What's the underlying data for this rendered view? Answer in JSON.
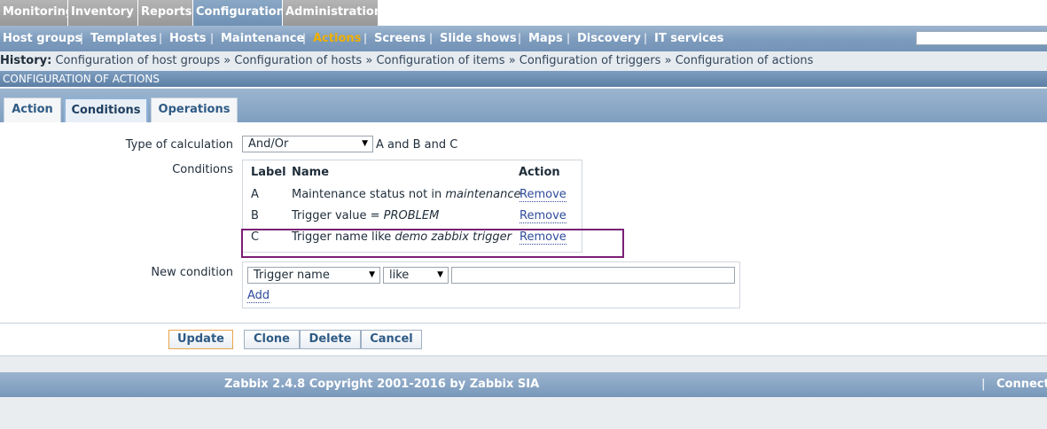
{
  "top_menu": [
    {
      "label": "Monitoring",
      "active": false
    },
    {
      "label": "Inventory",
      "active": false
    },
    {
      "label": "Reports",
      "active": false
    },
    {
      "label": "Configuration",
      "active": true
    },
    {
      "label": "Administration",
      "active": false
    }
  ],
  "sub_menu": [
    {
      "label": "Host groups",
      "active": false
    },
    {
      "label": "Templates",
      "active": false
    },
    {
      "label": "Hosts",
      "active": false
    },
    {
      "label": "Maintenance",
      "active": false
    },
    {
      "label": "Actions",
      "active": true
    },
    {
      "label": "Screens",
      "active": false
    },
    {
      "label": "Slide shows",
      "active": false
    },
    {
      "label": "Maps",
      "active": false
    },
    {
      "label": "Discovery",
      "active": false
    },
    {
      "label": "IT services",
      "active": false
    }
  ],
  "history": {
    "label": "History:",
    "items": [
      "Configuration of host groups",
      "Configuration of hosts",
      "Configuration of items",
      "Configuration of triggers",
      "Configuration of actions"
    ],
    "separator": "»"
  },
  "section_title": "CONFIGURATION OF ACTIONS",
  "tabs": [
    {
      "label": "Action",
      "active": false
    },
    {
      "label": "Conditions",
      "active": true
    },
    {
      "label": "Operations",
      "active": false
    }
  ],
  "form": {
    "type_of_calculation_label": "Type of calculation",
    "type_of_calculation_value": "And/Or",
    "calculation_formula": "A and B and C",
    "conditions_label": "Conditions",
    "conditions_table": {
      "headers": [
        "Label",
        "Name",
        "Action"
      ],
      "rows": [
        {
          "label": "A",
          "name_prefix": "Maintenance status not in ",
          "name_value": "maintenance",
          "action": "Remove"
        },
        {
          "label": "B",
          "name_prefix": "Trigger value = ",
          "name_value": "PROBLEM",
          "action": "Remove"
        },
        {
          "label": "C",
          "name_prefix": "Trigger name like ",
          "name_value": "demo zabbix trigger",
          "action": "Remove"
        }
      ]
    },
    "new_condition_label": "New condition",
    "new_condition_type": "Trigger name",
    "new_condition_operator": "like",
    "new_condition_value": "",
    "add_label": "Add"
  },
  "buttons": {
    "update": "Update",
    "clone": "Clone",
    "delete": "Delete",
    "cancel": "Cancel"
  },
  "footer": {
    "copyright": "Zabbix 2.4.8 Copyright 2001-2016 by Zabbix SIA",
    "separator": "|",
    "status": "Connected"
  },
  "colors": {
    "accent": "#f0b000",
    "highlight": "#7b1e75",
    "link": "#2f4b9a"
  }
}
